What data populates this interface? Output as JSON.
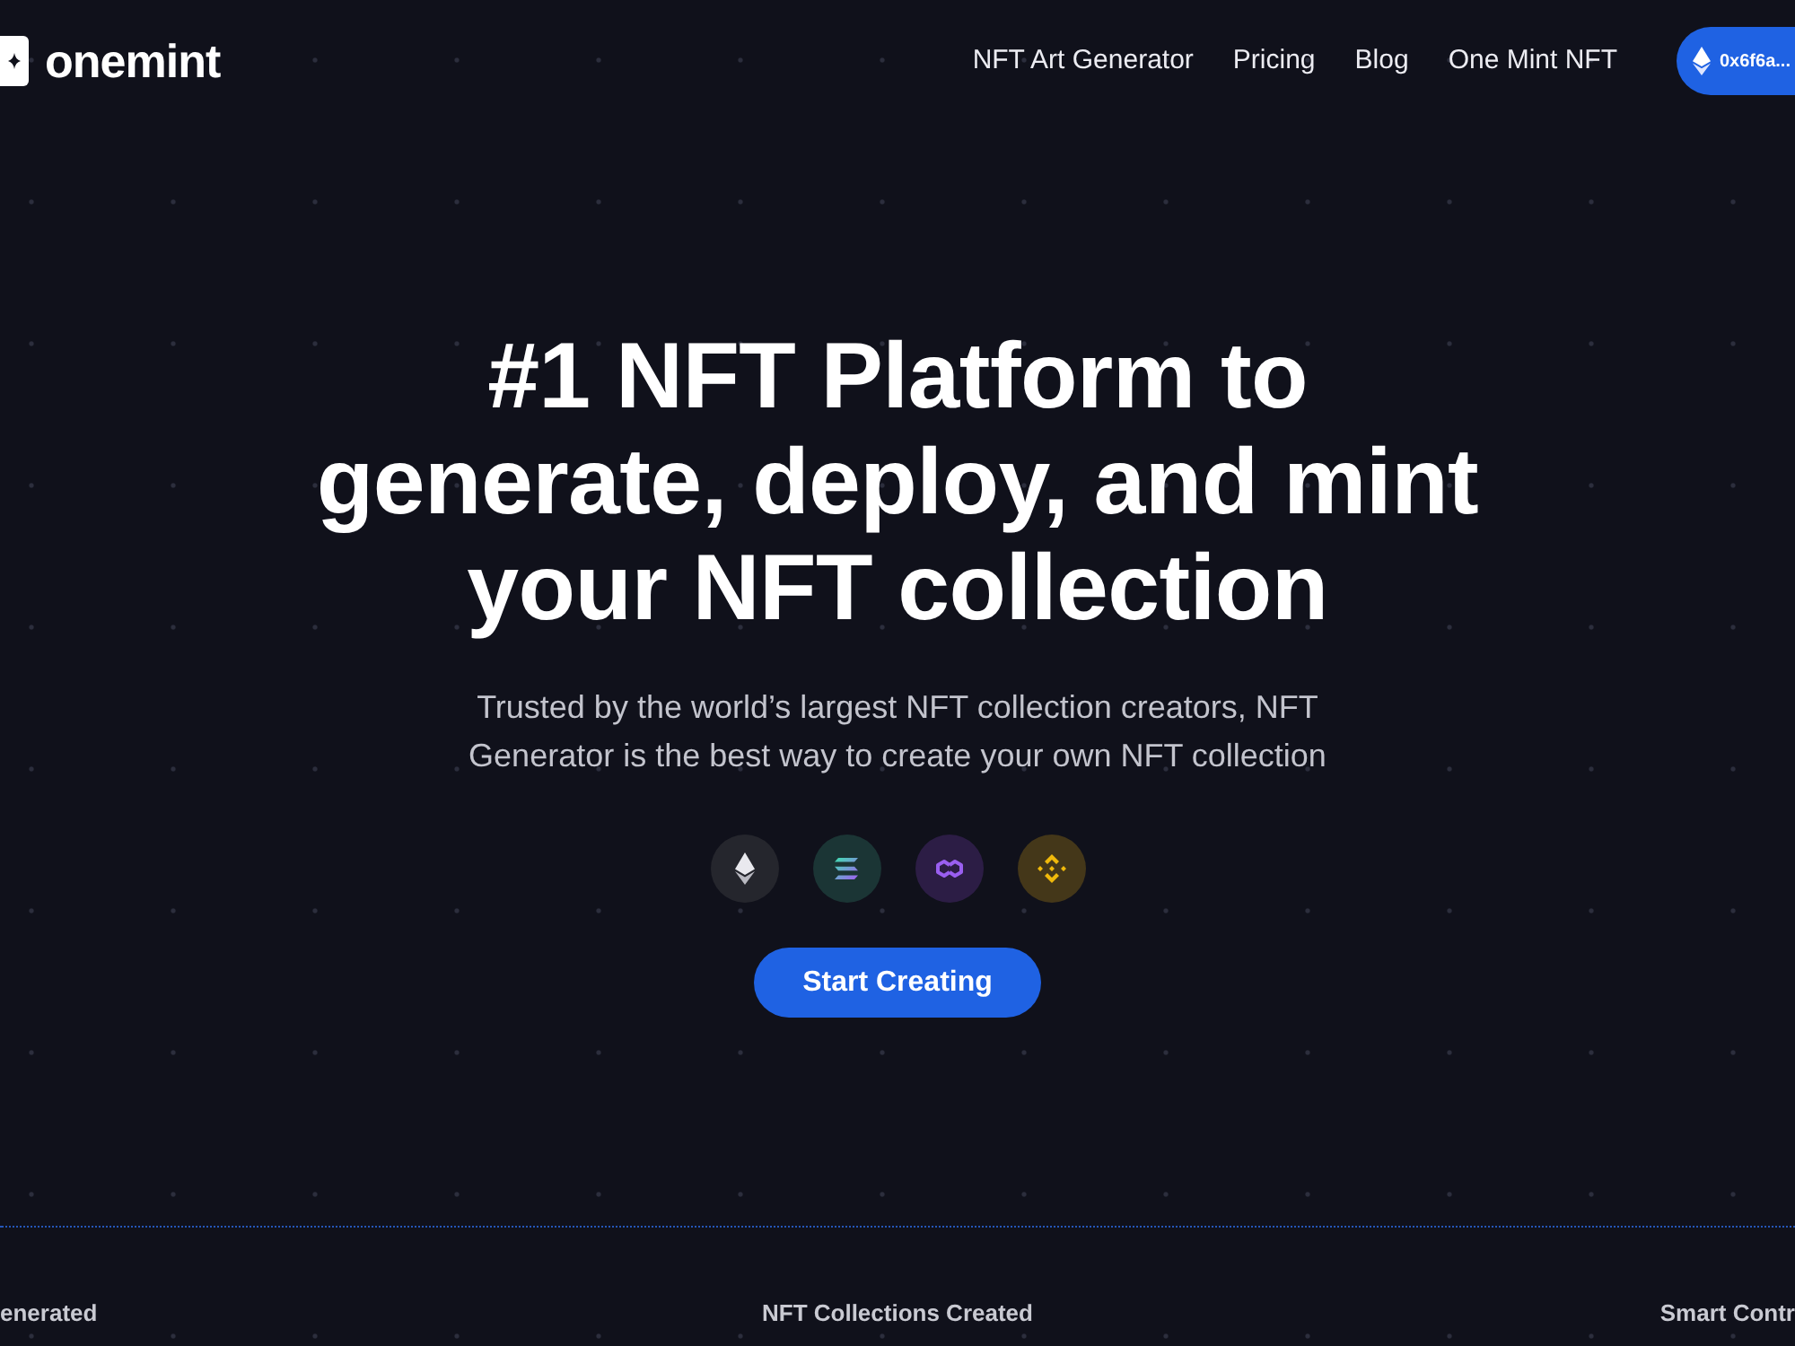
{
  "header": {
    "logo": "onemint",
    "nav": [
      "NFT Art Generator",
      "Pricing",
      "Blog",
      "One Mint NFT"
    ],
    "wallet_button": "0x6f6a..."
  },
  "hero": {
    "title": "#1 NFT Platform to generate, deploy, and mint your NFT collection",
    "subtitle": "Trusted by the world’s largest NFT collection creators, NFT Generator is the best way to create your own NFT collection",
    "cta": "Start Creating"
  },
  "stats": [
    "enerated",
    "NFT Collections Created",
    "Smart Contr"
  ]
}
